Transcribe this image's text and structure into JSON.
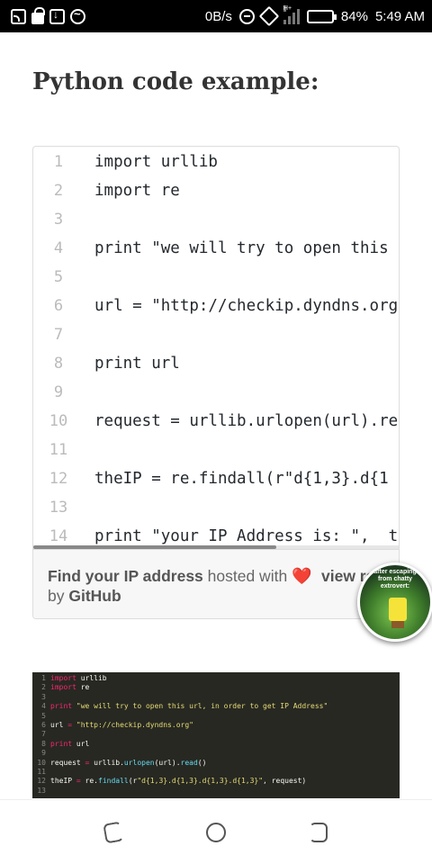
{
  "status_bar": {
    "net_speed": "0B/s",
    "battery_percent": "84%",
    "battery_level": 0.84,
    "time": "5:49 AM",
    "network_type": "H+",
    "icons": [
      "cast-icon",
      "lock-icon",
      "download-icon",
      "messenger-icon",
      "dnd-icon",
      "rotate-icon",
      "signal-icon",
      "battery-icon"
    ]
  },
  "heading": "Python code example:",
  "gist": {
    "lines": [
      {
        "num": "1",
        "text": "import urllib"
      },
      {
        "num": "2",
        "text": "import re"
      },
      {
        "num": "3",
        "text": ""
      },
      {
        "num": "4",
        "text": "print \"we will try to open this"
      },
      {
        "num": "5",
        "text": ""
      },
      {
        "num": "6",
        "text": "url = \"http://checkip.dyndns.org"
      },
      {
        "num": "7",
        "text": ""
      },
      {
        "num": "8",
        "text": "print url"
      },
      {
        "num": "9",
        "text": ""
      },
      {
        "num": "10",
        "text": "request = urllib.urlopen(url).re"
      },
      {
        "num": "11",
        "text": ""
      },
      {
        "num": "12",
        "text": "theIP = re.findall(r\"d{1,3}.d{1"
      },
      {
        "num": "13",
        "text": ""
      },
      {
        "num": "14",
        "text": "print \"your IP Address is: \",  t"
      }
    ],
    "footer": {
      "file_name": "Find your IP address",
      "hosted_with": "hosted with",
      "view_raw": "view ra",
      "by": "by",
      "github": "GitHub"
    }
  },
  "bubble": {
    "caption": "after escaping from chatty extrovert:"
  },
  "dark_code": {
    "lines": [
      {
        "num": "1",
        "parts": [
          {
            "c": "kw",
            "t": "import"
          },
          {
            "c": "",
            "t": " urllib"
          }
        ]
      },
      {
        "num": "2",
        "parts": [
          {
            "c": "kw",
            "t": "import"
          },
          {
            "c": "",
            "t": " re"
          }
        ]
      },
      {
        "num": "3",
        "parts": []
      },
      {
        "num": "4",
        "parts": [
          {
            "c": "kw",
            "t": "print"
          },
          {
            "c": "str",
            "t": " \"we will try to open this url, in order to get IP Address\""
          }
        ]
      },
      {
        "num": "5",
        "parts": []
      },
      {
        "num": "6",
        "parts": [
          {
            "c": "",
            "t": "url "
          },
          {
            "c": "kw",
            "t": "="
          },
          {
            "c": "str",
            "t": " \"http://checkip.dyndns.org\""
          }
        ]
      },
      {
        "num": "7",
        "parts": []
      },
      {
        "num": "8",
        "parts": [
          {
            "c": "kw",
            "t": "print"
          },
          {
            "c": "",
            "t": " url"
          }
        ]
      },
      {
        "num": "9",
        "parts": []
      },
      {
        "num": "10",
        "parts": [
          {
            "c": "",
            "t": "request "
          },
          {
            "c": "kw",
            "t": "="
          },
          {
            "c": "",
            "t": " urllib."
          },
          {
            "c": "fn",
            "t": "urlopen"
          },
          {
            "c": "",
            "t": "(url)."
          },
          {
            "c": "fn",
            "t": "read"
          },
          {
            "c": "",
            "t": "()"
          }
        ]
      },
      {
        "num": "11",
        "parts": []
      },
      {
        "num": "12",
        "parts": [
          {
            "c": "",
            "t": "theIP "
          },
          {
            "c": "kw",
            "t": "="
          },
          {
            "c": "",
            "t": " re."
          },
          {
            "c": "fn",
            "t": "findall"
          },
          {
            "c": "",
            "t": "(r"
          },
          {
            "c": "str",
            "t": "\"d{1,3}.d{1,3}.d{1,3}.d{1,3}\""
          },
          {
            "c": "",
            "t": ", request)"
          }
        ]
      },
      {
        "num": "13",
        "parts": []
      }
    ]
  },
  "nav_bar": {
    "icons": [
      "back-icon",
      "home-icon",
      "recents-icon"
    ]
  },
  "colors": {
    "heart": "#d8232a",
    "dark_code_bg": "#272822"
  }
}
